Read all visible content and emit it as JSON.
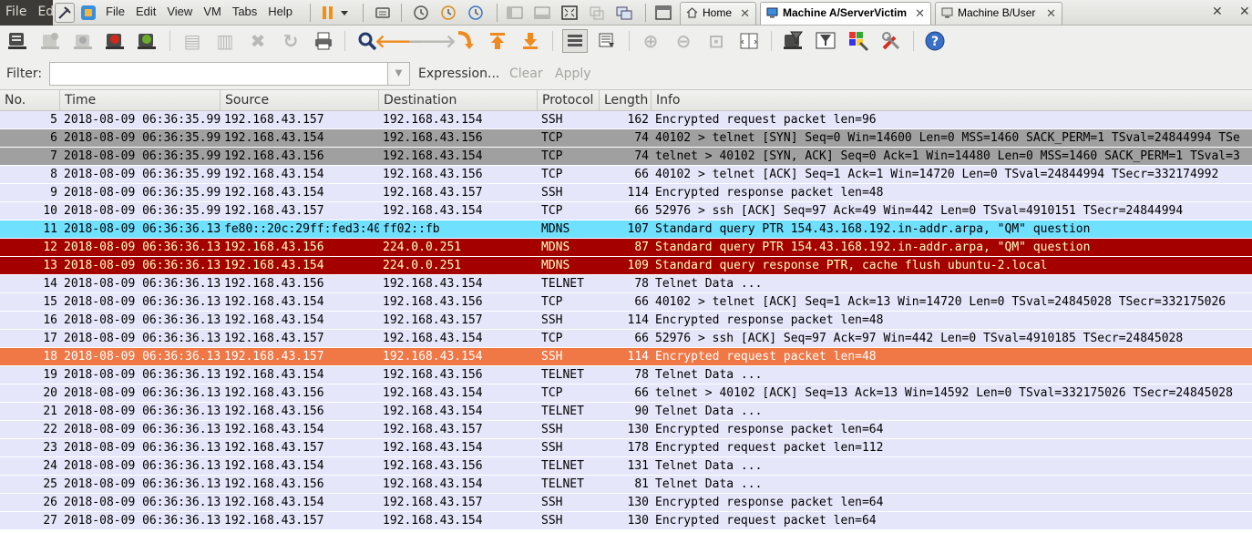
{
  "workspace_menu": {
    "file": "File",
    "edit": "Ed"
  },
  "vm_menu": {
    "file": "File",
    "edit": "Edit",
    "view": "View",
    "vm": "VM",
    "tabs": "Tabs",
    "help": "Help"
  },
  "vm_tabs": [
    {
      "label": "Home",
      "active": false
    },
    {
      "label": "Machine A/ServerVictim",
      "active": true
    },
    {
      "label": "Machine B/User",
      "active": false
    }
  ],
  "filter": {
    "label": "Filter:",
    "value": "",
    "expression": "Expression...",
    "clear": "Clear",
    "apply": "Apply"
  },
  "columns": {
    "no": "No.",
    "time": "Time",
    "source": "Source",
    "destination": "Destination",
    "protocol": "Protocol",
    "length": "Length",
    "info": "Info"
  },
  "colors": {
    "default_bg": "#e6e6fa",
    "tcp_flag_bg": "#a0a0a0",
    "mdns_bg": "#70e0ff",
    "dark_red_bg": "#a40000",
    "selected_bg": "#f07746"
  },
  "packets": [
    {
      "no": "5",
      "time": "2018-08-09 06:36:35.99",
      "src": "192.168.43.157",
      "dst": "192.168.43.154",
      "proto": "SSH",
      "len": "162",
      "info": "Encrypted request packet len=96",
      "style": "default"
    },
    {
      "no": "6",
      "time": "2018-08-09 06:36:35.99",
      "src": "192.168.43.154",
      "dst": "192.168.43.156",
      "proto": "TCP",
      "len": "74",
      "info": "40102 > telnet [SYN] Seq=0 Win=14600 Len=0 MSS=1460 SACK_PERM=1 TSval=24844994 TSe",
      "style": "gray"
    },
    {
      "no": "7",
      "time": "2018-08-09 06:36:35.99",
      "src": "192.168.43.156",
      "dst": "192.168.43.154",
      "proto": "TCP",
      "len": "74",
      "info": "telnet > 40102 [SYN, ACK] Seq=0 Ack=1 Win=14480 Len=0 MSS=1460 SACK_PERM=1 TSval=3",
      "style": "gray"
    },
    {
      "no": "8",
      "time": "2018-08-09 06:36:35.99",
      "src": "192.168.43.154",
      "dst": "192.168.43.156",
      "proto": "TCP",
      "len": "66",
      "info": "40102 > telnet [ACK] Seq=1 Ack=1 Win=14720 Len=0 TSval=24844994 TSecr=332174992",
      "style": "default"
    },
    {
      "no": "9",
      "time": "2018-08-09 06:36:35.99",
      "src": "192.168.43.154",
      "dst": "192.168.43.157",
      "proto": "SSH",
      "len": "114",
      "info": "Encrypted response packet len=48",
      "style": "default"
    },
    {
      "no": "10",
      "time": "2018-08-09 06:36:35.99",
      "src": "192.168.43.157",
      "dst": "192.168.43.154",
      "proto": "TCP",
      "len": "66",
      "info": "52976 > ssh [ACK] Seq=97 Ack=49 Win=442 Len=0 TSval=4910151 TSecr=24844994",
      "style": "default"
    },
    {
      "no": "11",
      "time": "2018-08-09 06:36:36.13",
      "src": "fe80::20c:29ff:fed3:40",
      "dst": "ff02::fb",
      "proto": "MDNS",
      "len": "107",
      "info": "Standard query PTR 154.43.168.192.in-addr.arpa, \"QM\" question",
      "style": "cyan"
    },
    {
      "no": "12",
      "time": "2018-08-09 06:36:36.13",
      "src": "192.168.43.156",
      "dst": "224.0.0.251",
      "proto": "MDNS",
      "len": "87",
      "info": "Standard query PTR 154.43.168.192.in-addr.arpa, \"QM\" question",
      "style": "darkred"
    },
    {
      "no": "13",
      "time": "2018-08-09 06:36:36.13",
      "src": "192.168.43.154",
      "dst": "224.0.0.251",
      "proto": "MDNS",
      "len": "109",
      "info": "Standard query response PTR, cache flush ubuntu-2.local",
      "style": "darkred"
    },
    {
      "no": "14",
      "time": "2018-08-09 06:36:36.13",
      "src": "192.168.43.156",
      "dst": "192.168.43.154",
      "proto": "TELNET",
      "len": "78",
      "info": "Telnet Data ...",
      "style": "default"
    },
    {
      "no": "15",
      "time": "2018-08-09 06:36:36.13",
      "src": "192.168.43.154",
      "dst": "192.168.43.156",
      "proto": "TCP",
      "len": "66",
      "info": "40102 > telnet [ACK] Seq=1 Ack=13 Win=14720 Len=0 TSval=24845028 TSecr=332175026",
      "style": "default"
    },
    {
      "no": "16",
      "time": "2018-08-09 06:36:36.13",
      "src": "192.168.43.154",
      "dst": "192.168.43.157",
      "proto": "SSH",
      "len": "114",
      "info": "Encrypted response packet len=48",
      "style": "default"
    },
    {
      "no": "17",
      "time": "2018-08-09 06:36:36.13",
      "src": "192.168.43.157",
      "dst": "192.168.43.154",
      "proto": "TCP",
      "len": "66",
      "info": "52976 > ssh [ACK] Seq=97 Ack=97 Win=442 Len=0 TSval=4910185 TSecr=24845028",
      "style": "default"
    },
    {
      "no": "18",
      "time": "2018-08-09 06:36:36.13",
      "src": "192.168.43.157",
      "dst": "192.168.43.154",
      "proto": "SSH",
      "len": "114",
      "info": "Encrypted request packet len=48",
      "style": "selected"
    },
    {
      "no": "19",
      "time": "2018-08-09 06:36:36.13",
      "src": "192.168.43.154",
      "dst": "192.168.43.156",
      "proto": "TELNET",
      "len": "78",
      "info": "Telnet Data ...",
      "style": "default"
    },
    {
      "no": "20",
      "time": "2018-08-09 06:36:36.13",
      "src": "192.168.43.156",
      "dst": "192.168.43.154",
      "proto": "TCP",
      "len": "66",
      "info": "telnet > 40102 [ACK] Seq=13 Ack=13 Win=14592 Len=0 TSval=332175026 TSecr=24845028",
      "style": "default"
    },
    {
      "no": "21",
      "time": "2018-08-09 06:36:36.13",
      "src": "192.168.43.156",
      "dst": "192.168.43.154",
      "proto": "TELNET",
      "len": "90",
      "info": "Telnet Data ...",
      "style": "default"
    },
    {
      "no": "22",
      "time": "2018-08-09 06:36:36.13",
      "src": "192.168.43.154",
      "dst": "192.168.43.157",
      "proto": "SSH",
      "len": "130",
      "info": "Encrypted response packet len=64",
      "style": "default"
    },
    {
      "no": "23",
      "time": "2018-08-09 06:36:36.13",
      "src": "192.168.43.157",
      "dst": "192.168.43.154",
      "proto": "SSH",
      "len": "178",
      "info": "Encrypted request packet len=112",
      "style": "default"
    },
    {
      "no": "24",
      "time": "2018-08-09 06:36:36.13",
      "src": "192.168.43.154",
      "dst": "192.168.43.156",
      "proto": "TELNET",
      "len": "131",
      "info": "Telnet Data ...",
      "style": "default"
    },
    {
      "no": "25",
      "time": "2018-08-09 06:36:36.13",
      "src": "192.168.43.156",
      "dst": "192.168.43.154",
      "proto": "TELNET",
      "len": "81",
      "info": "Telnet Data ...",
      "style": "default"
    },
    {
      "no": "26",
      "time": "2018-08-09 06:36:36.13",
      "src": "192.168.43.154",
      "dst": "192.168.43.157",
      "proto": "SSH",
      "len": "130",
      "info": "Encrypted response packet len=64",
      "style": "default"
    },
    {
      "no": "27",
      "time": "2018-08-09 06:36:36.13",
      "src": "192.168.43.157",
      "dst": "192.168.43.154",
      "proto": "SSH",
      "len": "130",
      "info": "Encrypted request packet len=64",
      "style": "default"
    }
  ]
}
